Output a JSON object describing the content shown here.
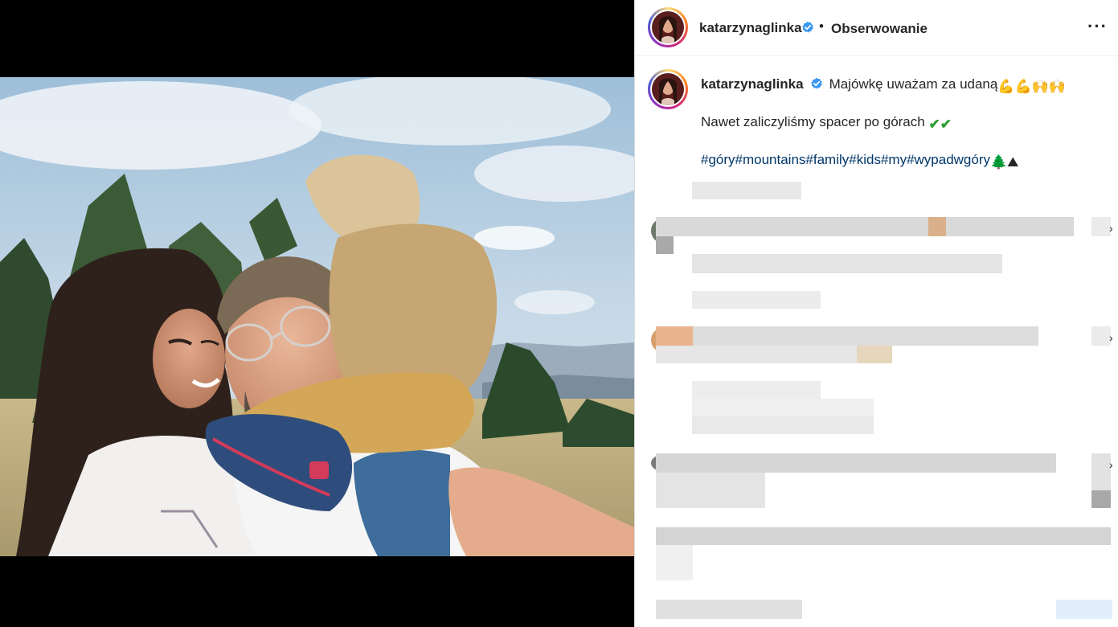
{
  "post": {
    "username": "katarzynaglinka",
    "separator": "•",
    "follow_label": "Obserwowanie",
    "more_label": "···"
  },
  "caption": {
    "username": "katarzynaglinka",
    "line1": "Majówkę uważam za udaną",
    "line1_emoji": "💪💪🙌🙌",
    "line2": "Nawet zaliczyliśmy spacer po górach",
    "line2_emoji": "✔✔",
    "hashtags": "#góry#mountains#family#kids#my#wypadwgóry",
    "hashtags_emoji": "🌲⛰"
  },
  "icons": {
    "verified": "verified-badge-icon",
    "more": "more-options-icon",
    "chevron": "chevron-right-icon"
  },
  "colors": {
    "verified": "#3897f0",
    "link": "#00376b",
    "text": "#262626"
  }
}
